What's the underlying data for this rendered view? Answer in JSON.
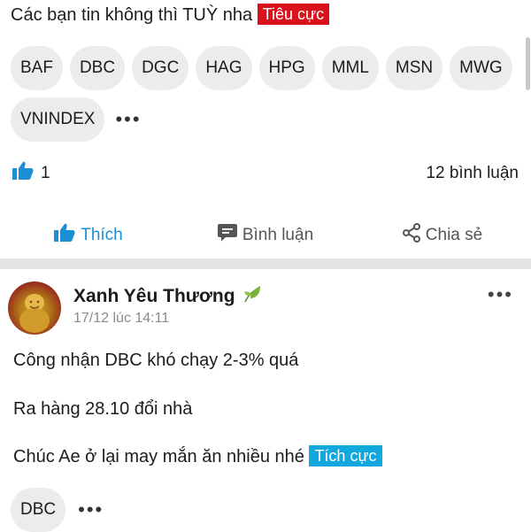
{
  "post1": {
    "text": "Các bạn tin không thì TUỲ nha",
    "badge": "Tiêu cực",
    "tickers": [
      "BAF",
      "DBC",
      "DGC",
      "HAG",
      "HPG",
      "MML",
      "MSN",
      "MWG",
      "VNINDEX"
    ],
    "more": "•••",
    "likes": "1",
    "comments": "12 bình luận"
  },
  "actions": {
    "like": "Thích",
    "comment": "Bình luận",
    "share": "Chia sẻ"
  },
  "post2": {
    "author": "Xanh Yêu Thương",
    "time": "17/12 lúc 14:11",
    "more": "•••",
    "line1": "Công nhận DBC khó chạy 2-3% quá",
    "line2": "Ra hàng 28.10 đổi nhà",
    "line3": "Chúc Ae ở lại may mắn ăn nhiều nhé",
    "badge": "Tích cực",
    "tickers": [
      "DBC"
    ],
    "tickers_more": "•••"
  },
  "colors": {
    "negative": "#d8131d",
    "positive": "#12a8dd",
    "accent": "#1b8fd6"
  }
}
